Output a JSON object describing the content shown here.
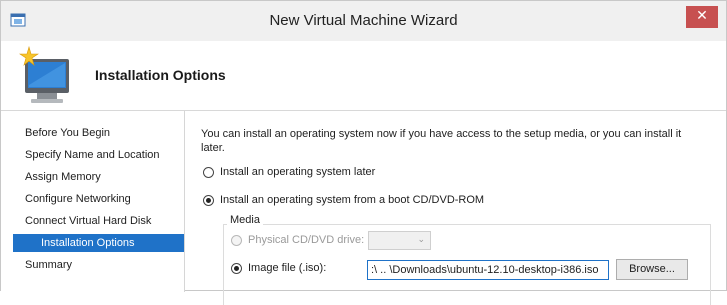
{
  "window": {
    "title": "New Virtual Machine Wizard",
    "close_glyph": "✕"
  },
  "header": {
    "title": "Installation Options",
    "icon": "monitor-starburst-icon"
  },
  "sidebar": {
    "items": [
      {
        "label": "Before You Begin",
        "active": false
      },
      {
        "label": "Specify Name and Location",
        "active": false
      },
      {
        "label": "Assign Memory",
        "active": false
      },
      {
        "label": "Configure Networking",
        "active": false
      },
      {
        "label": "Connect Virtual Hard Disk",
        "active": false
      },
      {
        "label": "Installation Options",
        "active": true
      },
      {
        "label": "Summary",
        "active": false
      }
    ]
  },
  "main": {
    "intro": "You can install an operating system now if you have access to the setup media, or you can install it later.",
    "option_later": "Install an operating system later",
    "option_cd": "Install an operating system from a boot CD/DVD-ROM",
    "media_legend": "Media",
    "physical_drive_label": "Physical CD/DVD drive:",
    "physical_drive_value": "",
    "image_file_label": "Image file (.iso):",
    "image_file_value": ":\\  .. \\Downloads\\ubuntu-12.10-desktop-i386.iso",
    "browse_label": "Browse..."
  },
  "colors": {
    "accent": "#1f72c8",
    "close": "#c75050"
  }
}
